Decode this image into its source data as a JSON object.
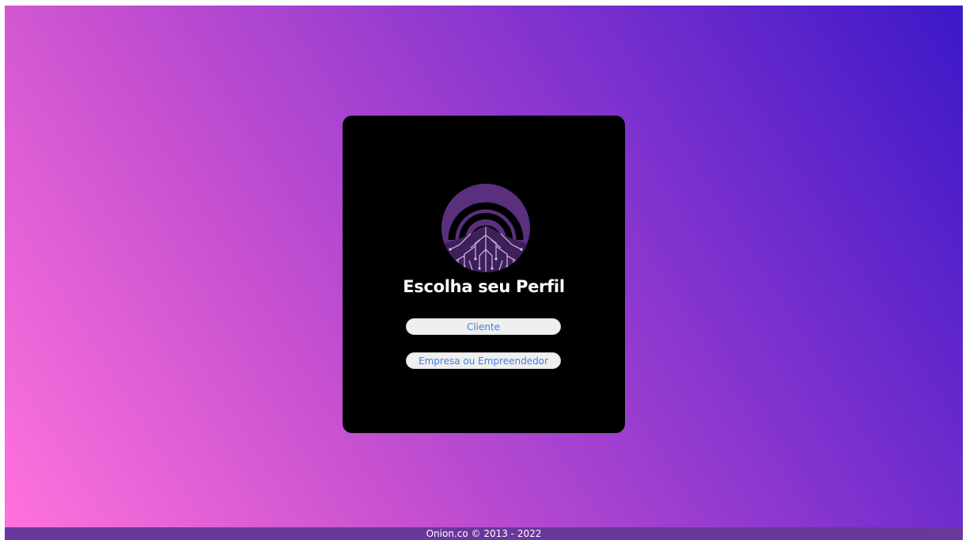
{
  "card": {
    "title": "Escolha seu Perfil",
    "logo_icon": "onion-signal-circuit-logo-icon"
  },
  "buttons": {
    "cliente_label": "Cliente",
    "empresa_label": "Empresa ou Empreendedor"
  },
  "footer": {
    "copyright": "Onion.co © 2013 - 2022"
  },
  "colors": {
    "gradient_start": "#ff72dc",
    "gradient_end": "#3c18c8",
    "card_bg": "#000000",
    "button_text": "#3f7fe0",
    "footer_bg": "#6a379c"
  }
}
